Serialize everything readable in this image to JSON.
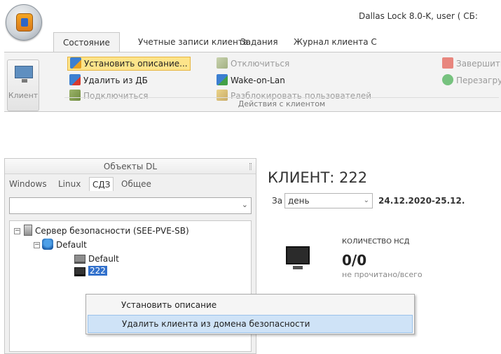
{
  "window": {
    "title": "Dallas Lock 8.0-K, user ( СБ:"
  },
  "tabs": [
    {
      "label": "Состояние",
      "active": true
    },
    {
      "label": "Учетные записи клиента",
      "active": false
    },
    {
      "label": "Задания",
      "active": false
    },
    {
      "label": "Журнал клиента С",
      "active": false
    }
  ],
  "ribbon": {
    "client_button": {
      "label": "Клиент",
      "icon": "monitor-icon"
    },
    "items": {
      "set_description": {
        "label": "Установить описание...",
        "icon": "computer-edit-icon",
        "highlighted": true
      },
      "remove_from_db": {
        "label": "Удалить из ДБ",
        "icon": "computer-remove-icon"
      },
      "connect": {
        "label": "Подключиться",
        "icon": "plug-icon",
        "disabled": true
      },
      "disconnect": {
        "label": "Отключиться",
        "icon": "unplug-icon",
        "disabled": true
      },
      "wake_on_lan": {
        "label": "Wake-on-Lan",
        "icon": "wake-icon"
      },
      "unlock_users": {
        "label": "Разблокировать пользователей",
        "icon": "unlock-users-icon",
        "disabled": true
      },
      "shutdown": {
        "label": "Завершить",
        "icon": "stop-icon",
        "disabled": true
      },
      "reboot": {
        "label": "Перезагру",
        "icon": "reboot-icon",
        "disabled": true
      }
    },
    "group_label": "Действия с клиентом"
  },
  "left_panel": {
    "header": "Объекты DL",
    "subtabs": [
      {
        "label": "Windows",
        "active": false
      },
      {
        "label": "Linux",
        "active": false
      },
      {
        "label": "СДЗ",
        "active": true
      },
      {
        "label": "Общее",
        "active": false
      }
    ],
    "combo_value": "",
    "tree": {
      "server": "Сервер безопасности (SEE-PVE-SB)",
      "domain": "Default",
      "client_default": "Default",
      "client_selected": "222"
    }
  },
  "context_menu": {
    "items": [
      {
        "label": "Установить описание",
        "hover": false
      },
      {
        "label": "Удалить клиента из домена безопасности",
        "hover": true
      }
    ]
  },
  "right_panel": {
    "title": "КЛИЕНТ: 222",
    "period_prefix": "За",
    "period_value": "день",
    "date_range": "24.12.2020-25.12.",
    "kpi": {
      "title": "КОЛИЧЕСТВО НСД",
      "value": "0/0",
      "subtitle": "не прочитано/всего"
    }
  },
  "colors": {
    "ribbon_bg": "#f3f3f3",
    "highlight": "#fde48a",
    "selection": "#3271cc",
    "menu_hover": "#cfe3f7"
  }
}
